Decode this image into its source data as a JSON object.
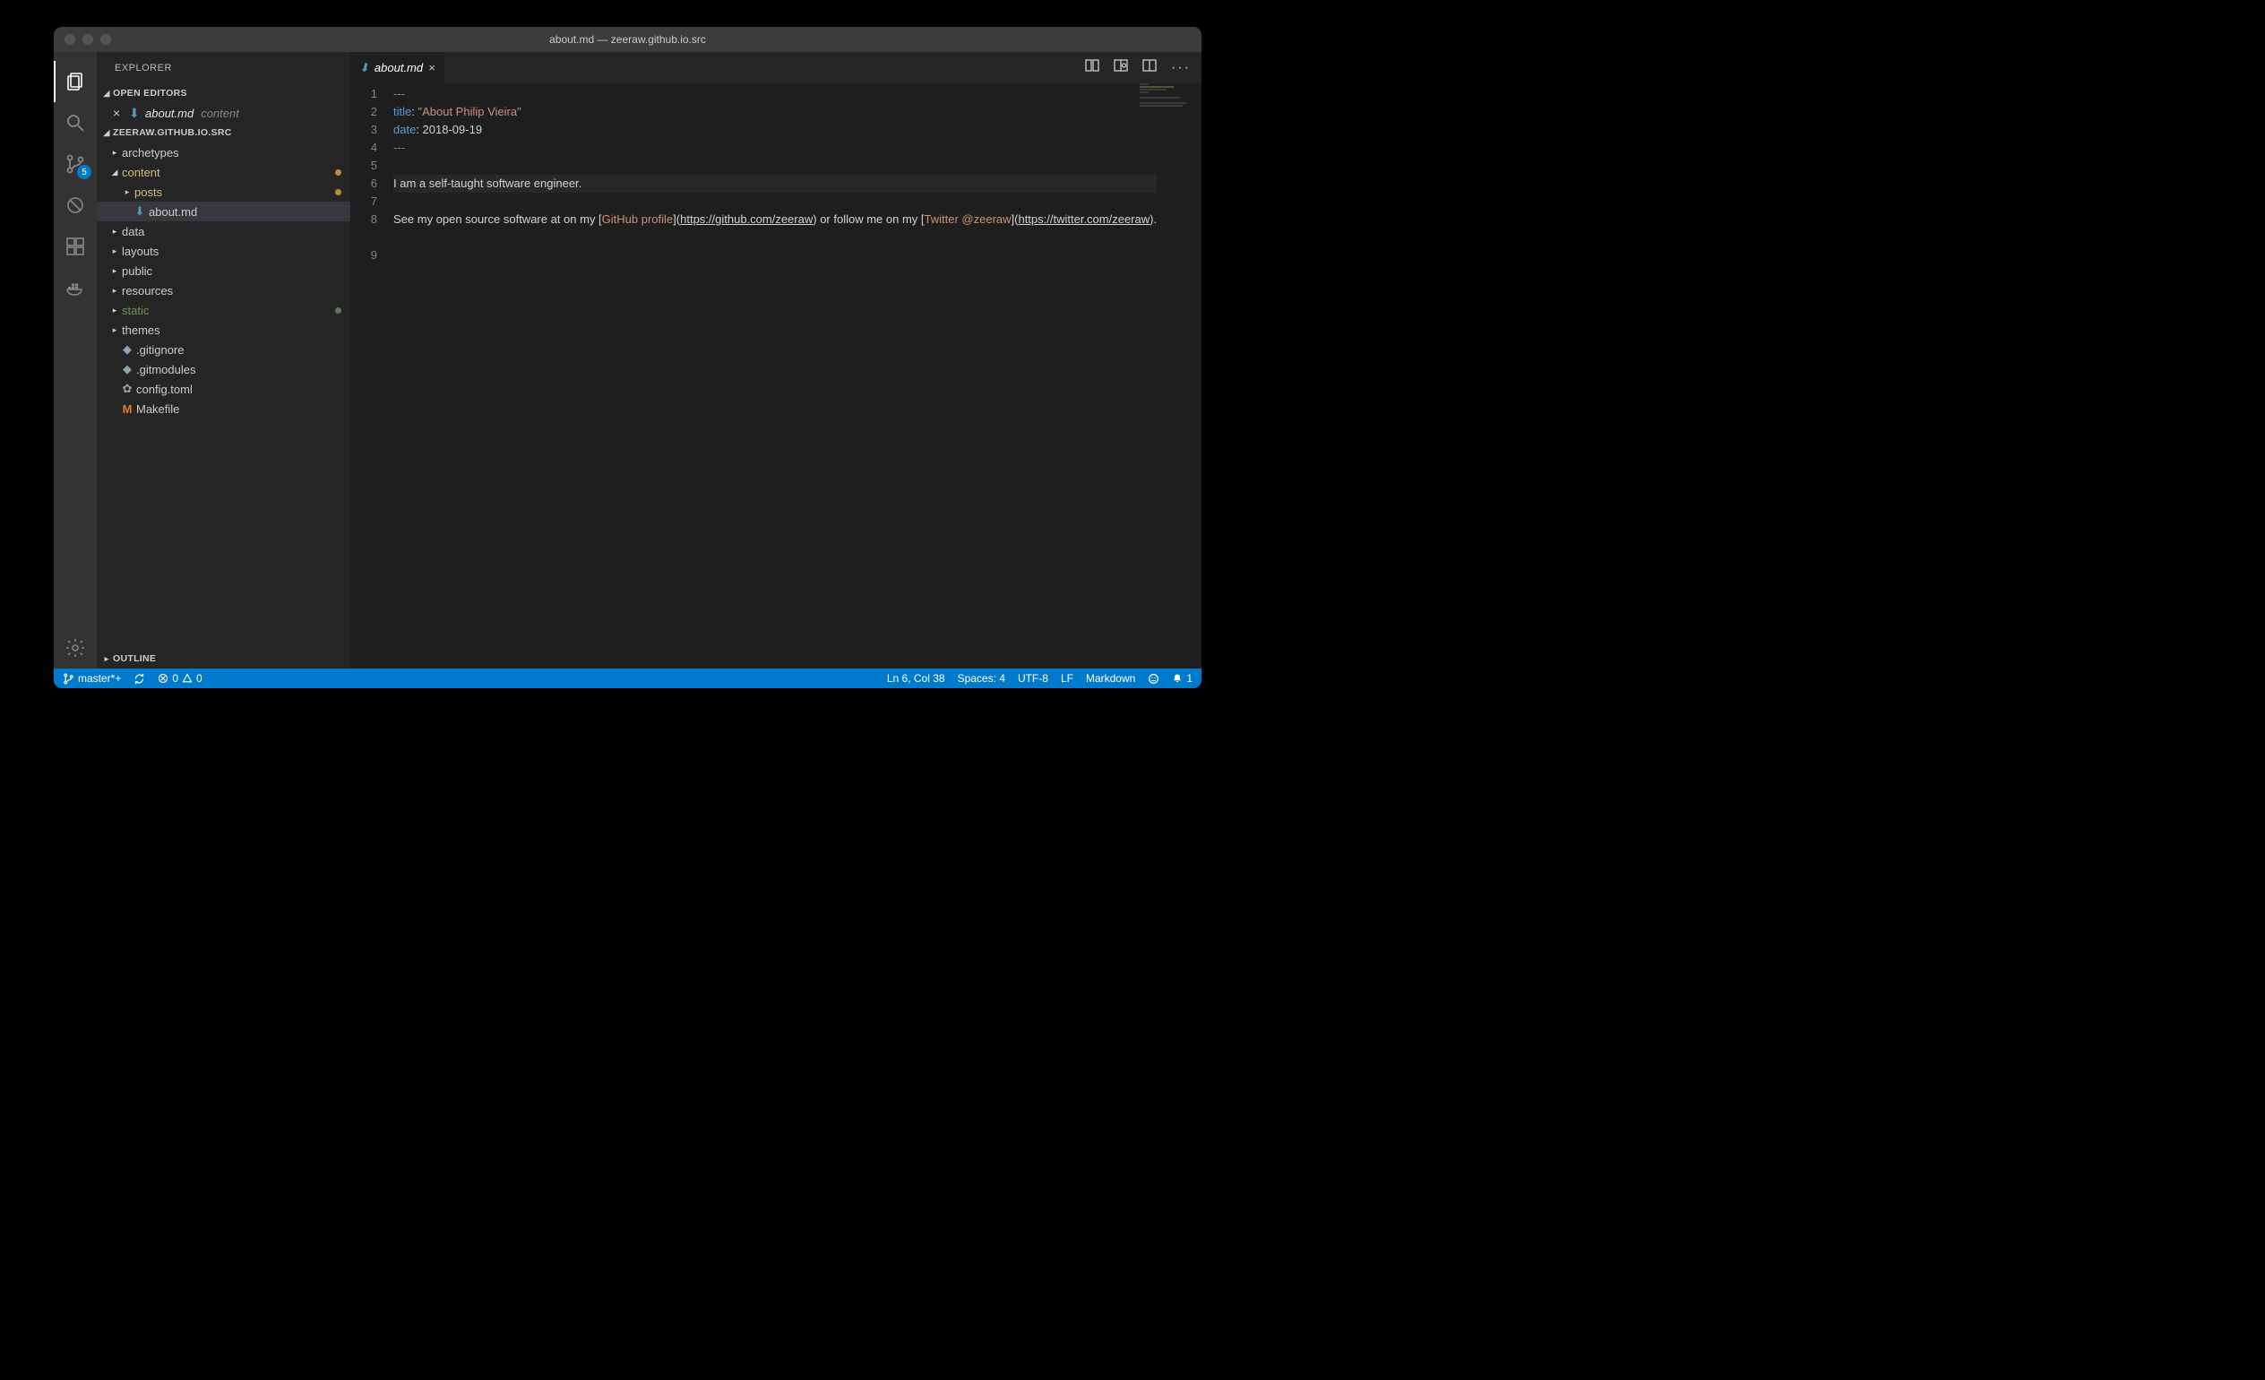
{
  "titlebar": {
    "title": "about.md — zeeraw.github.io.src"
  },
  "activity": {
    "scm_badge": "5"
  },
  "sidebar": {
    "title": "EXPLORER",
    "sections": {
      "open_editors": "OPEN EDITORS",
      "project": "ZEERAW.GITHUB.IO.SRC",
      "outline": "OUTLINE"
    },
    "open_editor": {
      "name": "about.md",
      "path": "content"
    },
    "tree": {
      "archetypes": "archetypes",
      "content": "content",
      "posts": "posts",
      "about": "about.md",
      "data": "data",
      "layouts": "layouts",
      "public": "public",
      "resources": "resources",
      "static": "static",
      "themes": "themes",
      "gitignore": ".gitignore",
      "gitmodules": ".gitmodules",
      "config": "config.toml",
      "makefile": "Makefile"
    }
  },
  "tabs": {
    "active": "about.md"
  },
  "editor": {
    "l1": "---",
    "l2_key": "title",
    "l2_sep": ": ",
    "l2_val": "\"About Philip Vieira\"",
    "l3_key": "date",
    "l3_sep": ": ",
    "l3_val": "2018-09-19",
    "l4": "---",
    "l6": "I am a self-taught software engineer.",
    "l8a": "See my open source software at on my [",
    "l8_link1": "GitHub profile",
    "l8b": "](",
    "l8_url1": "https://github.com/zeeraw",
    "l8c": ") or follow me on my [",
    "l8_link2": "Twitter @zeeraw",
    "l8d": "](",
    "l8_url2": "https://twitter.com/zeeraw",
    "l8e": ").",
    "lines": [
      "1",
      "2",
      "3",
      "4",
      "5",
      "6",
      "7",
      "8",
      "",
      "9"
    ]
  },
  "status": {
    "branch": "master*+",
    "errors": "0",
    "warnings": "0",
    "cursor": "Ln 6, Col 38",
    "spaces": "Spaces: 4",
    "encoding": "UTF-8",
    "eol": "LF",
    "lang": "Markdown",
    "bell": "1"
  }
}
